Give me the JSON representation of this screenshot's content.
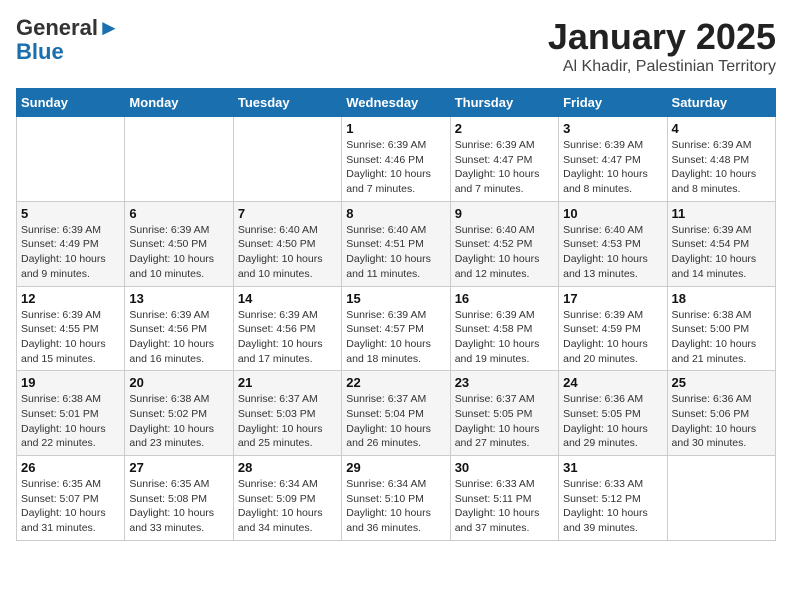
{
  "logo": {
    "line1": "General",
    "line2": "Blue"
  },
  "title": "January 2025",
  "subtitle": "Al Khadir, Palestinian Territory",
  "headers": [
    "Sunday",
    "Monday",
    "Tuesday",
    "Wednesday",
    "Thursday",
    "Friday",
    "Saturday"
  ],
  "weeks": [
    [
      {
        "num": "",
        "sunrise": "",
        "sunset": "",
        "daylight": ""
      },
      {
        "num": "",
        "sunrise": "",
        "sunset": "",
        "daylight": ""
      },
      {
        "num": "",
        "sunrise": "",
        "sunset": "",
        "daylight": ""
      },
      {
        "num": "1",
        "sunrise": "Sunrise: 6:39 AM",
        "sunset": "Sunset: 4:46 PM",
        "daylight": "Daylight: 10 hours and 7 minutes."
      },
      {
        "num": "2",
        "sunrise": "Sunrise: 6:39 AM",
        "sunset": "Sunset: 4:47 PM",
        "daylight": "Daylight: 10 hours and 7 minutes."
      },
      {
        "num": "3",
        "sunrise": "Sunrise: 6:39 AM",
        "sunset": "Sunset: 4:47 PM",
        "daylight": "Daylight: 10 hours and 8 minutes."
      },
      {
        "num": "4",
        "sunrise": "Sunrise: 6:39 AM",
        "sunset": "Sunset: 4:48 PM",
        "daylight": "Daylight: 10 hours and 8 minutes."
      }
    ],
    [
      {
        "num": "5",
        "sunrise": "Sunrise: 6:39 AM",
        "sunset": "Sunset: 4:49 PM",
        "daylight": "Daylight: 10 hours and 9 minutes."
      },
      {
        "num": "6",
        "sunrise": "Sunrise: 6:39 AM",
        "sunset": "Sunset: 4:50 PM",
        "daylight": "Daylight: 10 hours and 10 minutes."
      },
      {
        "num": "7",
        "sunrise": "Sunrise: 6:40 AM",
        "sunset": "Sunset: 4:50 PM",
        "daylight": "Daylight: 10 hours and 10 minutes."
      },
      {
        "num": "8",
        "sunrise": "Sunrise: 6:40 AM",
        "sunset": "Sunset: 4:51 PM",
        "daylight": "Daylight: 10 hours and 11 minutes."
      },
      {
        "num": "9",
        "sunrise": "Sunrise: 6:40 AM",
        "sunset": "Sunset: 4:52 PM",
        "daylight": "Daylight: 10 hours and 12 minutes."
      },
      {
        "num": "10",
        "sunrise": "Sunrise: 6:40 AM",
        "sunset": "Sunset: 4:53 PM",
        "daylight": "Daylight: 10 hours and 13 minutes."
      },
      {
        "num": "11",
        "sunrise": "Sunrise: 6:39 AM",
        "sunset": "Sunset: 4:54 PM",
        "daylight": "Daylight: 10 hours and 14 minutes."
      }
    ],
    [
      {
        "num": "12",
        "sunrise": "Sunrise: 6:39 AM",
        "sunset": "Sunset: 4:55 PM",
        "daylight": "Daylight: 10 hours and 15 minutes."
      },
      {
        "num": "13",
        "sunrise": "Sunrise: 6:39 AM",
        "sunset": "Sunset: 4:56 PM",
        "daylight": "Daylight: 10 hours and 16 minutes."
      },
      {
        "num": "14",
        "sunrise": "Sunrise: 6:39 AM",
        "sunset": "Sunset: 4:56 PM",
        "daylight": "Daylight: 10 hours and 17 minutes."
      },
      {
        "num": "15",
        "sunrise": "Sunrise: 6:39 AM",
        "sunset": "Sunset: 4:57 PM",
        "daylight": "Daylight: 10 hours and 18 minutes."
      },
      {
        "num": "16",
        "sunrise": "Sunrise: 6:39 AM",
        "sunset": "Sunset: 4:58 PM",
        "daylight": "Daylight: 10 hours and 19 minutes."
      },
      {
        "num": "17",
        "sunrise": "Sunrise: 6:39 AM",
        "sunset": "Sunset: 4:59 PM",
        "daylight": "Daylight: 10 hours and 20 minutes."
      },
      {
        "num": "18",
        "sunrise": "Sunrise: 6:38 AM",
        "sunset": "Sunset: 5:00 PM",
        "daylight": "Daylight: 10 hours and 21 minutes."
      }
    ],
    [
      {
        "num": "19",
        "sunrise": "Sunrise: 6:38 AM",
        "sunset": "Sunset: 5:01 PM",
        "daylight": "Daylight: 10 hours and 22 minutes."
      },
      {
        "num": "20",
        "sunrise": "Sunrise: 6:38 AM",
        "sunset": "Sunset: 5:02 PM",
        "daylight": "Daylight: 10 hours and 23 minutes."
      },
      {
        "num": "21",
        "sunrise": "Sunrise: 6:37 AM",
        "sunset": "Sunset: 5:03 PM",
        "daylight": "Daylight: 10 hours and 25 minutes."
      },
      {
        "num": "22",
        "sunrise": "Sunrise: 6:37 AM",
        "sunset": "Sunset: 5:04 PM",
        "daylight": "Daylight: 10 hours and 26 minutes."
      },
      {
        "num": "23",
        "sunrise": "Sunrise: 6:37 AM",
        "sunset": "Sunset: 5:05 PM",
        "daylight": "Daylight: 10 hours and 27 minutes."
      },
      {
        "num": "24",
        "sunrise": "Sunrise: 6:36 AM",
        "sunset": "Sunset: 5:05 PM",
        "daylight": "Daylight: 10 hours and 29 minutes."
      },
      {
        "num": "25",
        "sunrise": "Sunrise: 6:36 AM",
        "sunset": "Sunset: 5:06 PM",
        "daylight": "Daylight: 10 hours and 30 minutes."
      }
    ],
    [
      {
        "num": "26",
        "sunrise": "Sunrise: 6:35 AM",
        "sunset": "Sunset: 5:07 PM",
        "daylight": "Daylight: 10 hours and 31 minutes."
      },
      {
        "num": "27",
        "sunrise": "Sunrise: 6:35 AM",
        "sunset": "Sunset: 5:08 PM",
        "daylight": "Daylight: 10 hours and 33 minutes."
      },
      {
        "num": "28",
        "sunrise": "Sunrise: 6:34 AM",
        "sunset": "Sunset: 5:09 PM",
        "daylight": "Daylight: 10 hours and 34 minutes."
      },
      {
        "num": "29",
        "sunrise": "Sunrise: 6:34 AM",
        "sunset": "Sunset: 5:10 PM",
        "daylight": "Daylight: 10 hours and 36 minutes."
      },
      {
        "num": "30",
        "sunrise": "Sunrise: 6:33 AM",
        "sunset": "Sunset: 5:11 PM",
        "daylight": "Daylight: 10 hours and 37 minutes."
      },
      {
        "num": "31",
        "sunrise": "Sunrise: 6:33 AM",
        "sunset": "Sunset: 5:12 PM",
        "daylight": "Daylight: 10 hours and 39 minutes."
      },
      {
        "num": "",
        "sunrise": "",
        "sunset": "",
        "daylight": ""
      }
    ]
  ]
}
